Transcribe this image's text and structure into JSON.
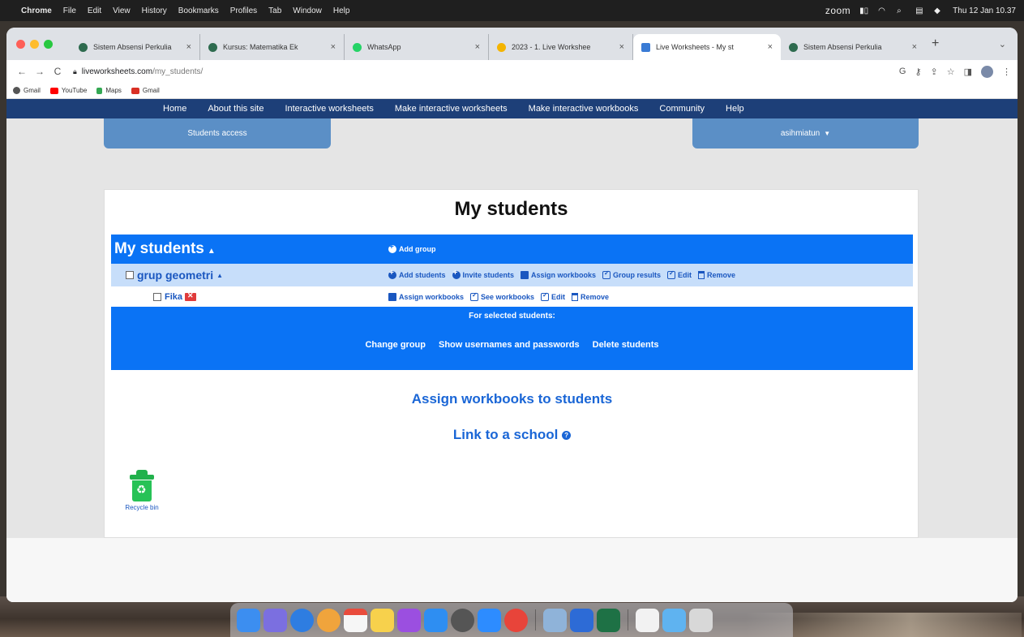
{
  "menubar": {
    "app": "Chrome",
    "menus": [
      "File",
      "Edit",
      "View",
      "History",
      "Bookmarks",
      "Profiles",
      "Tab",
      "Window",
      "Help"
    ],
    "zoom_label": "zoom",
    "datetime": "Thu 12 Jan 10.37"
  },
  "tabs": [
    {
      "title": "Sistem Absensi Perkulia",
      "icon_color": "#2e6b4f",
      "active": false
    },
    {
      "title": "Kursus: Matematika Ek",
      "icon_color": "#2e6b4f",
      "active": false
    },
    {
      "title": "WhatsApp",
      "icon_color": "#25d366",
      "active": false
    },
    {
      "title": "2023 - 1. Live Workshee",
      "icon_color": "#f4b400",
      "active": false
    },
    {
      "title": "Live Worksheets - My st",
      "icon_color": "#3a7bd5",
      "active": true
    },
    {
      "title": "Sistem Absensi Perkulia",
      "icon_color": "#2e6b4f",
      "active": false
    }
  ],
  "toolbar": {
    "url_domain": "liveworksheets.com",
    "url_path": "/my_students/",
    "back": "←",
    "forward": "→",
    "reload": "C"
  },
  "bookmarks": [
    {
      "label": "Gmail",
      "icon_color": "#555"
    },
    {
      "label": "YouTube",
      "icon_color": "#ff0000"
    },
    {
      "label": "Maps",
      "icon_color": "#34a853"
    },
    {
      "label": "Gmail",
      "icon_color": "#d93025"
    }
  ],
  "site_nav": [
    "Home",
    "About this site",
    "Interactive worksheets",
    "Make interactive worksheets",
    "Make interactive workbooks",
    "Community",
    "Help"
  ],
  "students_access": "Students access",
  "user_menu": "asihmiatun",
  "page_title": "My students",
  "table": {
    "root_label": "My students",
    "add_group": "Add group",
    "group": {
      "name": "grup geometri",
      "actions": {
        "add_students": "Add students",
        "invite_students": "Invite students",
        "assign_workbooks": "Assign workbooks",
        "group_results": "Group results",
        "edit": "Edit",
        "remove": "Remove"
      }
    },
    "student": {
      "name": "Fika",
      "actions": {
        "assign_workbooks": "Assign workbooks",
        "see_workbooks": "See workbooks",
        "edit": "Edit",
        "remove": "Remove"
      }
    },
    "selected_header": "For selected students:",
    "selected_ops": {
      "change_group": "Change group",
      "show_credentials": "Show usernames and passwords",
      "delete_students": "Delete students"
    }
  },
  "assign_link": "Assign workbooks to students",
  "school_link": "Link to a school",
  "recycle_bin": "Recycle bin",
  "colors": {
    "nav_bg": "#1d3f78",
    "primary_blue": "#0a73f5",
    "group_bg": "#c7defa",
    "link_blue": "#1a66d6"
  },
  "dock_icons": [
    "finder",
    "launchpad",
    "safari",
    "photos",
    "calendar",
    "notes",
    "podcasts",
    "app-store",
    "system-preferences",
    "zoom-app",
    "chrome",
    "preview",
    "zoom",
    "excel",
    "file",
    "folder",
    "trash"
  ]
}
